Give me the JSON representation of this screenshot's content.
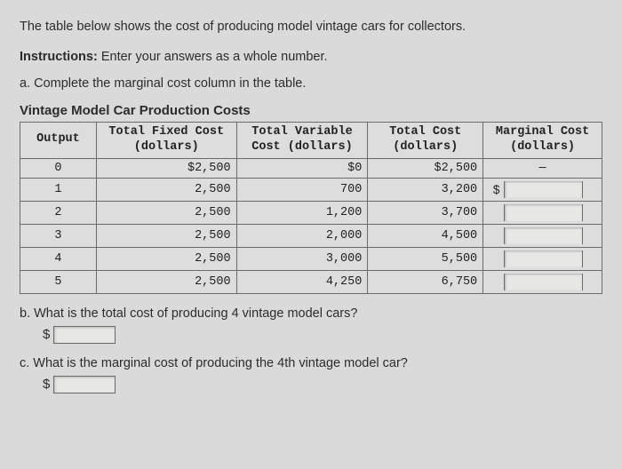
{
  "intro": "The table below shows the cost of producing model vintage cars for collectors.",
  "instructions_label": "Instructions:",
  "instructions_text": " Enter your answers as a whole number.",
  "part_a": "a. Complete the marginal cost column in the table.",
  "table_title": "Vintage Model Car Production Costs",
  "headers": {
    "output": "Output",
    "tfc": "Total Fixed Cost (dollars)",
    "tvc": "Total Variable Cost (dollars)",
    "tc": "Total Cost (dollars)",
    "mc": "Marginal Cost (dollars)"
  },
  "rows": [
    {
      "output": "0",
      "tfc": "$2,500",
      "tvc": "$0",
      "tc": "$2,500",
      "mc_dash": "—"
    },
    {
      "output": "1",
      "tfc": "2,500",
      "tvc": "700",
      "tc": "3,200",
      "mc_dollar": "$"
    },
    {
      "output": "2",
      "tfc": "2,500",
      "tvc": "1,200",
      "tc": "3,700"
    },
    {
      "output": "3",
      "tfc": "2,500",
      "tvc": "2,000",
      "tc": "4,500"
    },
    {
      "output": "4",
      "tfc": "2,500",
      "tvc": "3,000",
      "tc": "5,500"
    },
    {
      "output": "5",
      "tfc": "2,500",
      "tvc": "4,250",
      "tc": "6,750"
    }
  ],
  "part_b": "b. What is the total cost of producing 4 vintage model cars?",
  "part_c": "c. What is the marginal cost of producing the 4th vintage model car?",
  "dollar": "$"
}
